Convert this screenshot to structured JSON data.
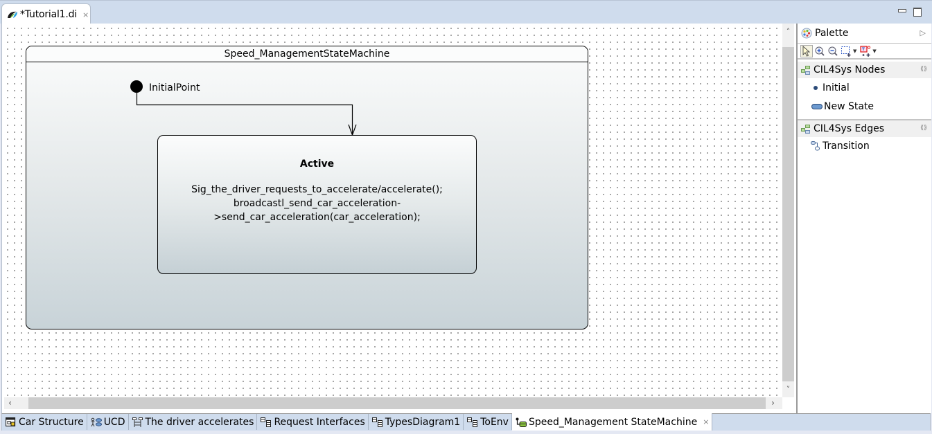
{
  "editor_tab": {
    "label": "*Tutorial1.di",
    "close_icon": "close-x"
  },
  "diagram": {
    "state_machine": {
      "name": "Speed_ManagementStateMachine"
    },
    "initial": {
      "label": "InitialPoint"
    },
    "states": [
      {
        "name": "Active",
        "body": "Sig_the_driver_requests_to_accelerate/accelerate();\nbroadcastl_send_car_acceleration-\n>send_car_acceleration(car_acceleration);"
      }
    ],
    "transitions": [
      {
        "from": "InitialPoint",
        "to": "Active"
      }
    ]
  },
  "palette": {
    "title": "Palette",
    "tools": [
      {
        "name": "select-tool",
        "icon": "arrow-cursor"
      },
      {
        "name": "zoom-in-tool",
        "icon": "zoom-in"
      },
      {
        "name": "zoom-out-tool",
        "icon": "zoom-out"
      },
      {
        "name": "marquee-tool",
        "icon": "marquee"
      },
      {
        "name": "connection-marquee-tool",
        "icon": "connection-marquee"
      }
    ],
    "drawers": [
      {
        "label": "CIL4Sys Nodes",
        "items": [
          {
            "label": "Initial",
            "icon": "initial-dot"
          },
          {
            "label": "New State",
            "icon": "state-pill"
          }
        ]
      },
      {
        "label": "CIL4Sys Edges",
        "items": [
          {
            "label": "Transition",
            "icon": "transition"
          }
        ]
      }
    ]
  },
  "bottom_tabs": [
    {
      "label": "Car Structure",
      "icon": "composite-structure",
      "active": false
    },
    {
      "label": "UCD",
      "icon": "use-case",
      "active": false
    },
    {
      "label": "The driver accelerates",
      "icon": "sequence",
      "active": false
    },
    {
      "label": "Request Interfaces",
      "icon": "class-diagram",
      "active": false
    },
    {
      "label": "TypesDiagram1",
      "icon": "class-diagram",
      "active": false
    },
    {
      "label": "ToEnv",
      "icon": "class-diagram",
      "active": false
    },
    {
      "label": "Speed_Management StateMachine",
      "icon": "state-machine",
      "active": true
    }
  ],
  "colors": {
    "tab_bar_bg": "#cfdced",
    "state_gradient_top": "#fbfcfc",
    "state_gradient_bottom": "#c5d0d5"
  }
}
